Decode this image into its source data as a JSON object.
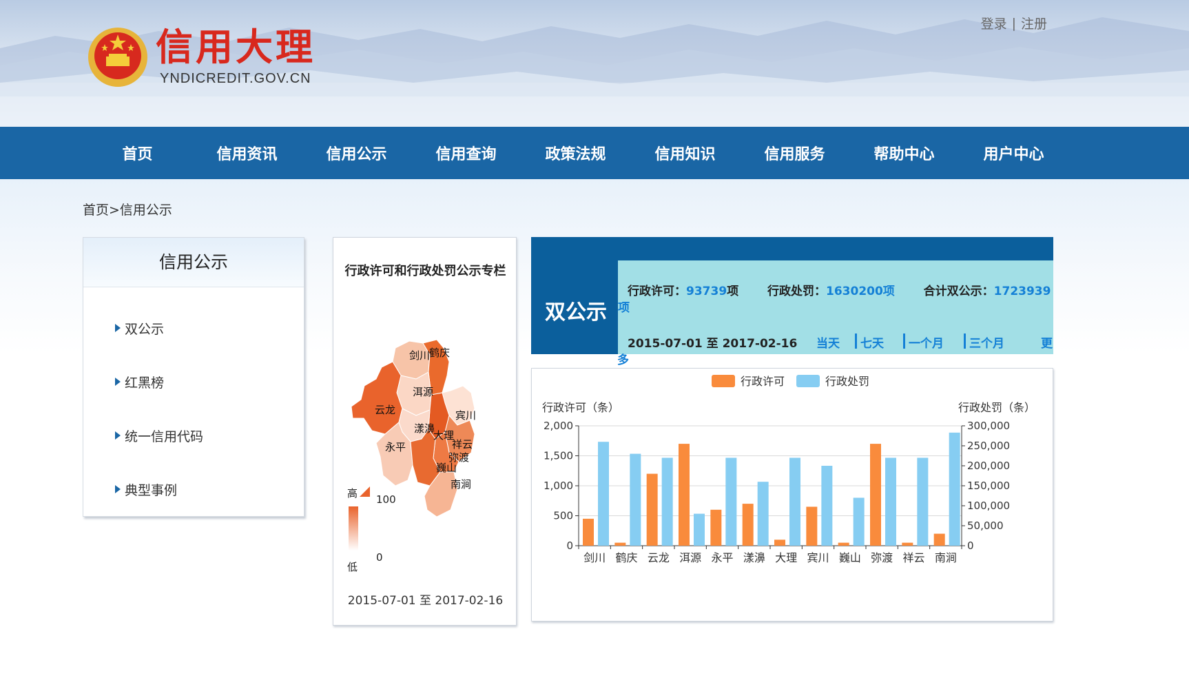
{
  "header": {
    "site_title": "信用大理",
    "site_url": "YNDICREDIT.GOV.CN",
    "login": "登录",
    "register": "注册",
    "separator": "|"
  },
  "nav": {
    "items": [
      "首页",
      "信用资讯",
      "信用公示",
      "信用查询",
      "政策法规",
      "信用知识",
      "信用服务",
      "帮助中心",
      "用户中心"
    ]
  },
  "breadcrumb": "首页>信用公示",
  "sidebar": {
    "title": "信用公示",
    "items": [
      "双公示",
      "红黑榜",
      "统一信用代码",
      "典型事例"
    ]
  },
  "map_panel": {
    "title": "行政许可和行政处罚公示专栏",
    "legend_high": "高",
    "legend_low": "低",
    "legend_max": "100",
    "legend_min": "0",
    "date_range": "2015-07-01 至 2017-02-16",
    "regions": [
      "剑川",
      "鹤庆",
      "洱源",
      "云龙",
      "宾川",
      "漾濞",
      "大理",
      "祥云",
      "永平",
      "弥渡",
      "巍山",
      "南涧"
    ]
  },
  "stats": {
    "label": "双公示",
    "permit_label": "行政许可：",
    "permit_value": "93739",
    "permit_unit": "项",
    "penalty_label": "行政处罚：",
    "penalty_value": "1630200项",
    "total_label": "合计双公示：",
    "total_value": "1723939",
    "total_unit": "项",
    "date_range": "2015-07-01 至 2017-02-16",
    "periods": [
      "当天",
      "七天",
      "一个月",
      "三个月",
      "更"
    ],
    "more_tail": "多"
  },
  "colors": {
    "nav_blue": "#1a66a5",
    "permit_orange": "#f98b3c",
    "penalty_blue": "#86cdf2",
    "title_red": "#d8281d",
    "stats_bg": "#0b5f9c",
    "stats_inner": "#a2dfe6",
    "link_blue": "#1480d6"
  },
  "chart_data": {
    "type": "bar",
    "categories": [
      "剑川",
      "鹤庆",
      "云龙",
      "洱源",
      "永平",
      "漾濞",
      "大理",
      "宾川",
      "巍山",
      "弥渡",
      "祥云",
      "南涧"
    ],
    "series": [
      {
        "name": "行政许可",
        "axis": "left",
        "color": "#f98b3c",
        "values": [
          450,
          50,
          1200,
          1700,
          600,
          700,
          100,
          650,
          50,
          1700,
          50,
          200
        ]
      },
      {
        "name": "行政处罚",
        "axis": "right",
        "color": "#86cdf2",
        "values": [
          260000,
          230000,
          220000,
          80000,
          220000,
          160000,
          220000,
          200000,
          120000,
          220000,
          220000,
          283000
        ]
      }
    ],
    "ylabel_left": "行政许可（条）",
    "ylabel_right": "行政处罚（条）",
    "ylim_left": [
      0,
      2000
    ],
    "ylim_right": [
      0,
      300000
    ],
    "yticks_left": [
      "0",
      "500",
      "1,000",
      "1,500",
      "2,000"
    ],
    "yticks_right": [
      "0",
      "50,000",
      "100,000",
      "150,000",
      "200,000",
      "250,000",
      "300,000"
    ],
    "legend_position": "top-center",
    "grid": true
  }
}
